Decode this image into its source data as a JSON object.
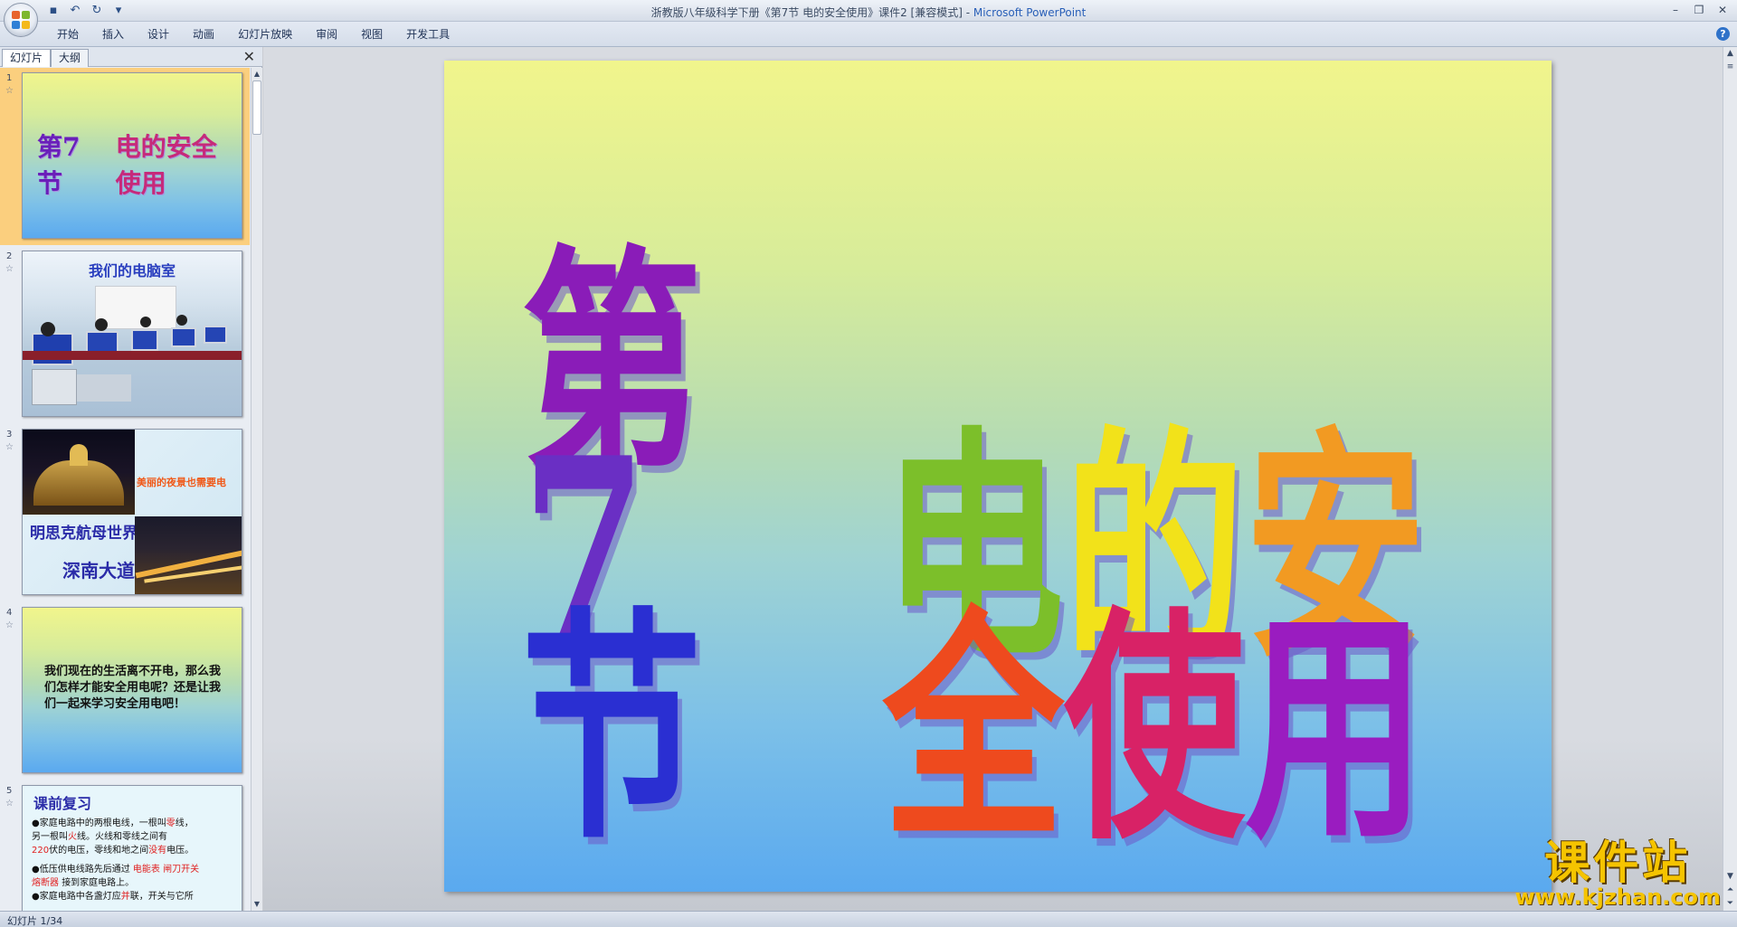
{
  "window": {
    "title": "浙教版八年级科学下册《第7节 电的安全使用》课件2 [兼容模式]",
    "title_sep": " - ",
    "app_name": "Microsoft PowerPoint"
  },
  "qat": {
    "save_icon": "save-icon",
    "undo_icon": "undo-icon",
    "redo_icon": "redo-icon",
    "customize_icon": "dropdown-icon"
  },
  "ribbon": {
    "tabs": [
      {
        "label": "开始"
      },
      {
        "label": "插入"
      },
      {
        "label": "设计"
      },
      {
        "label": "动画"
      },
      {
        "label": "幻灯片放映"
      },
      {
        "label": "审阅"
      },
      {
        "label": "视图"
      },
      {
        "label": "开发工具"
      }
    ],
    "help": "?"
  },
  "panel": {
    "tab_slides": "幻灯片",
    "tab_outline": "大纲",
    "close": "✕"
  },
  "thumbnails": [
    {
      "num": "1",
      "title_a": "第7节",
      "title_b": "电的安全使用"
    },
    {
      "num": "2",
      "title": "我们的电脑室"
    },
    {
      "num": "3",
      "caption": "美丽的夜景也需要电",
      "line1": "明思克航母世界",
      "line2": "深南大道"
    },
    {
      "num": "4",
      "text": "我们现在的生活离不开电，那么我们怎样才能安全用电呢？还是让我们一起来学习安全用电吧！"
    },
    {
      "num": "5",
      "title": "课前复习",
      "l1": "●家庭电路中的两根电线，一根叫",
      "a1": "零",
      "l1b": "线，",
      "l2": "另一根叫",
      "a2": "火",
      "l2b": "线。火线和零线之间有",
      "a3": "220",
      "l3": "伏的电压，零线和地之间",
      "a4": "没有",
      "l3b": "电压。",
      "l4": "●低压供电线路先后通过",
      "a5": "电能表",
      "a6": "闸刀开关",
      "a7": "熔断器",
      "l5": "接到家庭电路上。",
      "l6": "●家庭电路中各盏灯应",
      "a8": "并",
      "l6b": "联，开关与它所"
    }
  ],
  "slide": {
    "title_part1": "第7节",
    "title_part2": "电的安全使用",
    "colors": [
      "#8a1cb8",
      "#6a2fc4",
      "#2a2fd2",
      "#7cbf2a",
      "#f2e21a",
      "#f29a22",
      "#ee4a1e",
      "#d82266",
      "#9a1cc0"
    ]
  },
  "status": {
    "slide_counter": "幻灯片 1/34"
  },
  "watermark": {
    "cn": "课件站",
    "url": "www.kjzhan.com"
  }
}
